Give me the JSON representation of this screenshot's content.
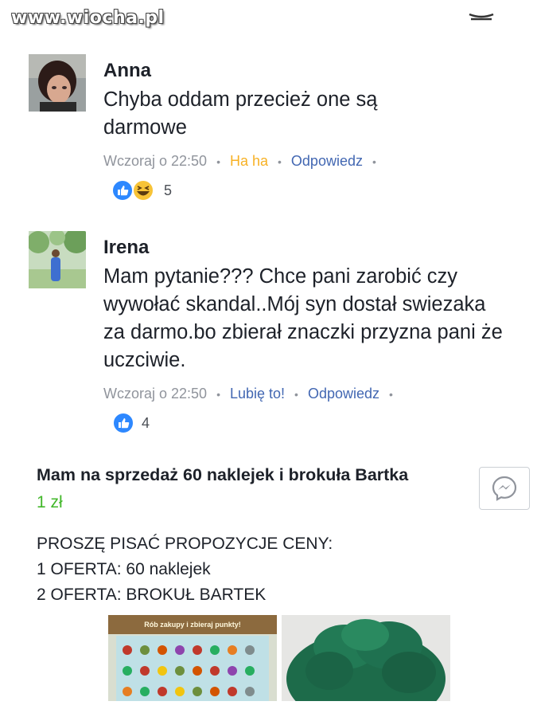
{
  "watermark": "www.wiocha.pl",
  "comments": [
    {
      "author": "Anna",
      "text": "Chyba oddam przecież one są darmowe",
      "time": "Wczoraj o 22:50",
      "action": "Ha ha",
      "reply": "Odpowiedz",
      "reaction_count": "5",
      "reactions": [
        "like-icon",
        "haha-icon"
      ]
    },
    {
      "author": "Irena",
      "text": "Mam pytanie??? Chce pani zarobić czy wywołać skandal..Mój syn dostał swiezaka za darmo.bo zbierał znaczki przyzna pani że uczciwie.",
      "time": "Wczoraj o 22:50",
      "action": "Lubię to!",
      "reply": "Odpowiedz",
      "reaction_count": "4",
      "reactions": [
        "like-icon"
      ]
    }
  ],
  "listing": {
    "title": "Mam na sprzedaż 60 naklejek i brokuła Bartka",
    "price": "1 zł",
    "description": [
      "PROSZĘ PISAĆ PROPOZYCJE CENY:",
      "1 OFERTA: 60 naklejek",
      "2 OFERTA: BROKUŁ BARTEK"
    ],
    "poster_text": "Rób zakupy i zbieraj punkty!"
  },
  "colors": {
    "link": "#4267b2",
    "haha": "#f7b125",
    "meta": "#90949c",
    "price": "#42b72a",
    "like_blue": "#2d88ff",
    "broccoli": "#1d6b4a"
  }
}
